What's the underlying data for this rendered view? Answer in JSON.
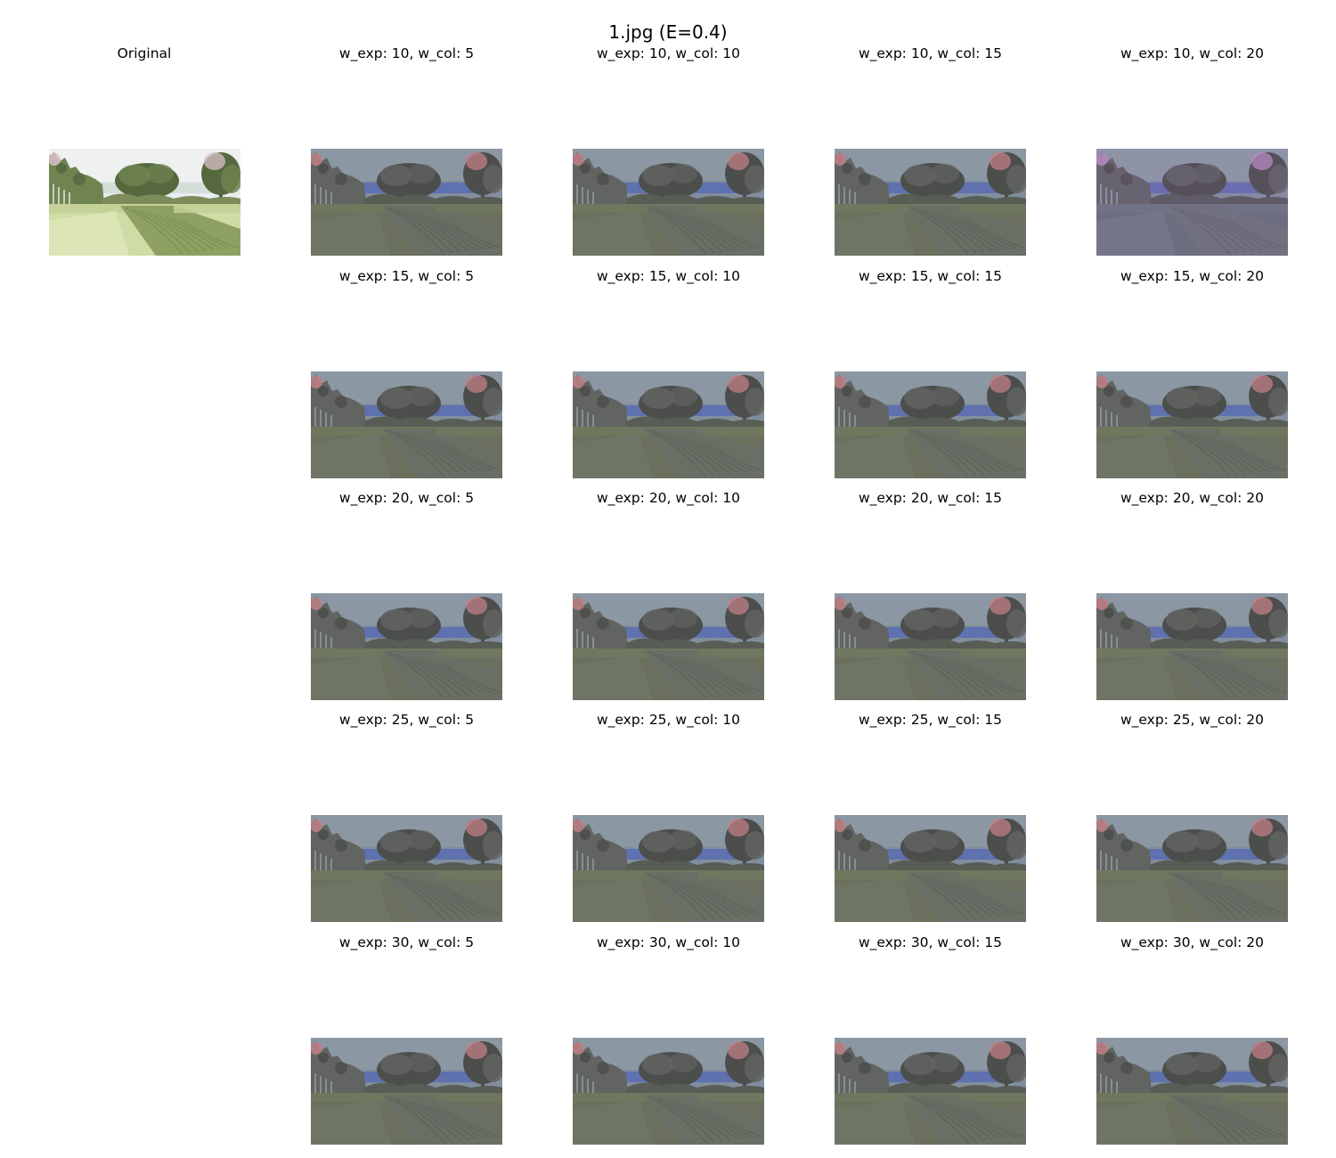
{
  "figure": {
    "title": "1.jpg (E=0.4)"
  },
  "original": {
    "title": "Original"
  },
  "grid": {
    "rows": [
      {
        "cells": [
          {
            "title": "w_exp: 10, w_col: 5",
            "tone": "dusk"
          },
          {
            "title": "w_exp: 10, w_col: 10",
            "tone": "dusk"
          },
          {
            "title": "w_exp: 10, w_col: 15",
            "tone": "dusk"
          },
          {
            "title": "w_exp: 10, w_col: 20",
            "tone": "purple"
          }
        ]
      },
      {
        "cells": [
          {
            "title": "w_exp: 15, w_col: 5",
            "tone": "dusk"
          },
          {
            "title": "w_exp: 15, w_col: 10",
            "tone": "dusk"
          },
          {
            "title": "w_exp: 15, w_col: 15",
            "tone": "dusk"
          },
          {
            "title": "w_exp: 15, w_col: 20",
            "tone": "dusk"
          }
        ]
      },
      {
        "cells": [
          {
            "title": "w_exp: 20, w_col: 5",
            "tone": "dusk"
          },
          {
            "title": "w_exp: 20, w_col: 10",
            "tone": "dusk"
          },
          {
            "title": "w_exp: 20, w_col: 15",
            "tone": "dusk"
          },
          {
            "title": "w_exp: 20, w_col: 20",
            "tone": "dusk"
          }
        ]
      },
      {
        "cells": [
          {
            "title": "w_exp: 25, w_col: 5",
            "tone": "dusk"
          },
          {
            "title": "w_exp: 25, w_col: 10",
            "tone": "dusk"
          },
          {
            "title": "w_exp: 25, w_col: 15",
            "tone": "dusk"
          },
          {
            "title": "w_exp: 25, w_col: 20",
            "tone": "dusk"
          }
        ]
      },
      {
        "cells": [
          {
            "title": "w_exp: 30, w_col: 5",
            "tone": "dusk"
          },
          {
            "title": "w_exp: 30, w_col: 10",
            "tone": "dusk"
          },
          {
            "title": "w_exp: 30, w_col: 15",
            "tone": "dusk"
          },
          {
            "title": "w_exp: 30, w_col: 20",
            "tone": "dusk"
          }
        ]
      }
    ]
  },
  "palettes": {
    "bright": {
      "sky": "#eef1f0",
      "skyLow": "#e6ecef",
      "haze": "#c9d6cc",
      "treeDark": "#56683e",
      "treeMid": "#6f8450",
      "pink": "#d9c0c8",
      "bush": "#7d8c5a",
      "fieldFar": "#c4d29a",
      "field": "#cfdca6",
      "fieldNear": "#dde6b8",
      "hay": "#8fa063",
      "hayLine": "#6c7d45",
      "post": "#eeeeee"
    },
    "dusk": {
      "sky": "#8b97a2",
      "skyLow": "#7e8c9c",
      "haze": "#4d62b8",
      "treeDark": "#4c4e4c",
      "treeMid": "#616460",
      "pink": "#c07f85",
      "bush": "#585d55",
      "fieldFar": "#6f775f",
      "field": "#6a705d",
      "fieldNear": "#707665",
      "hay": "#6a6f66",
      "hayLine": "#52574f",
      "post": "#9aa0a6"
    },
    "purple": {
      "sky": "#8e93a6",
      "skyLow": "#8487a0",
      "haze": "#5a60b8",
      "treeDark": "#55505a",
      "treeMid": "#686371",
      "pink": "#b58ac0",
      "bush": "#5f5c68",
      "fieldFar": "#727287",
      "field": "#6d6d80",
      "fieldNear": "#75758a",
      "hay": "#70707f",
      "hayLine": "#585868",
      "post": "#a2a3b0"
    }
  }
}
